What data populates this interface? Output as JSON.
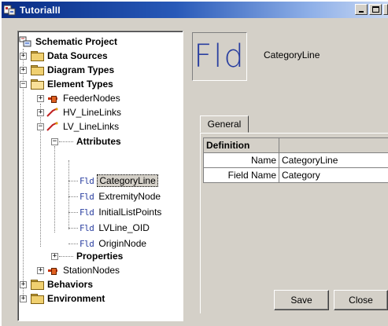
{
  "window": {
    "title": "TutorialII"
  },
  "tree": {
    "root": "Schematic Project",
    "data_sources": "Data Sources",
    "diagram_types": "Diagram Types",
    "element_types": "Element Types",
    "feeder_nodes": "FeederNodes",
    "hv_linelinks": "HV_LineLinks",
    "lv_linelinks": "LV_LineLinks",
    "attributes": "Attributes",
    "fields": [
      "CategoryLine",
      "ExtremityNode",
      "InitialListPoints",
      "LVLine_OID",
      "OriginNode"
    ],
    "field_prefix": "Fld",
    "properties": "Properties",
    "station_nodes": "StationNodes",
    "behaviors": "Behaviors",
    "environment": "Environment"
  },
  "detail": {
    "icon_text": "Fld",
    "name": "CategoryLine",
    "tab": "General",
    "grid": {
      "header": "Definition",
      "rows": [
        {
          "key": "Name",
          "value": "CategoryLine"
        },
        {
          "key": "Field Name",
          "value": "Category"
        }
      ]
    }
  },
  "buttons": {
    "save": "Save",
    "close": "Close"
  },
  "colors": {
    "titlebar": "#0a246a",
    "field_icon": "#2a3fa0",
    "window_bg": "#d4d0c8"
  }
}
